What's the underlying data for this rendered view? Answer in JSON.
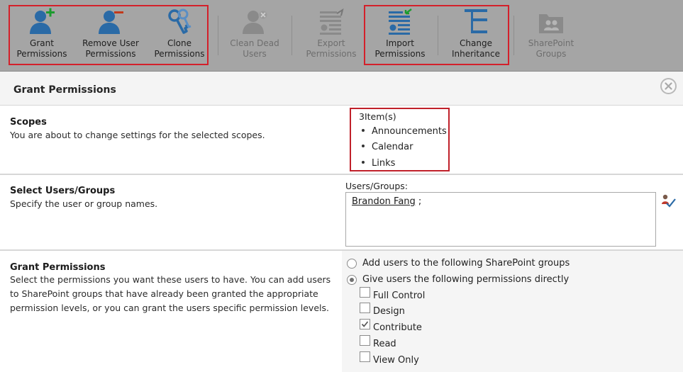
{
  "ribbon": {
    "buttons": [
      {
        "id": "grant",
        "label": "Grant\nPermissions",
        "icon": "user-add-icon",
        "enabled": true
      },
      {
        "id": "remove",
        "label": "Remove User\nPermissions",
        "icon": "user-remove-icon",
        "enabled": true
      },
      {
        "id": "clone",
        "label": "Clone\nPermissions",
        "icon": "keys-icon",
        "enabled": true
      },
      {
        "id": "clean",
        "label": "Clean Dead\nUsers",
        "icon": "user-clean-icon",
        "enabled": false
      },
      {
        "id": "export",
        "label": "Export\nPermissions",
        "icon": "export-icon",
        "enabled": false
      },
      {
        "id": "import",
        "label": "Import\nPermissions",
        "icon": "import-icon",
        "enabled": true
      },
      {
        "id": "inherit",
        "label": "Change\nInheritance",
        "icon": "hierarchy-icon",
        "enabled": true
      },
      {
        "id": "groups",
        "label": "SharePoint\nGroups",
        "icon": "groups-folder-icon",
        "enabled": false
      }
    ]
  },
  "dialog": {
    "title": "Grant Permissions",
    "scopes": {
      "title": "Scopes",
      "description": "You are about to change settings for the selected scopes.",
      "count_label": "3Item(s)",
      "items": [
        "Announcements",
        "Calendar",
        "Links"
      ]
    },
    "users": {
      "title": "Select Users/Groups",
      "description": "Specify the user or group names.",
      "field_label": "Users/Groups:",
      "value_name": "Brandon Fang",
      "value_suffix": " ;"
    },
    "grant": {
      "title": "Grant Permissions",
      "description": "Select the permissions you want these users to have. You can add users to SharePoint groups that have already been granted the appropriate permission levels, or you can grant the users specific permission levels.",
      "options": [
        {
          "label": "Add users to the following SharePoint groups",
          "selected": false
        },
        {
          "label": "Give users the following permissions directly",
          "selected": true
        }
      ],
      "levels": [
        {
          "label": "Full Control",
          "checked": false
        },
        {
          "label": "Design",
          "checked": false
        },
        {
          "label": "Contribute",
          "checked": true
        },
        {
          "label": "Read",
          "checked": false
        },
        {
          "label": "View Only",
          "checked": false
        }
      ]
    }
  },
  "colors": {
    "ribbon_bg": "#a5a5a5",
    "icon_blue": "#2a6aa6",
    "icon_disabled": "#8a8a8a",
    "highlight_red": "#d4202a",
    "add_green": "#1c9b2e",
    "remove_red": "#c2391b"
  }
}
